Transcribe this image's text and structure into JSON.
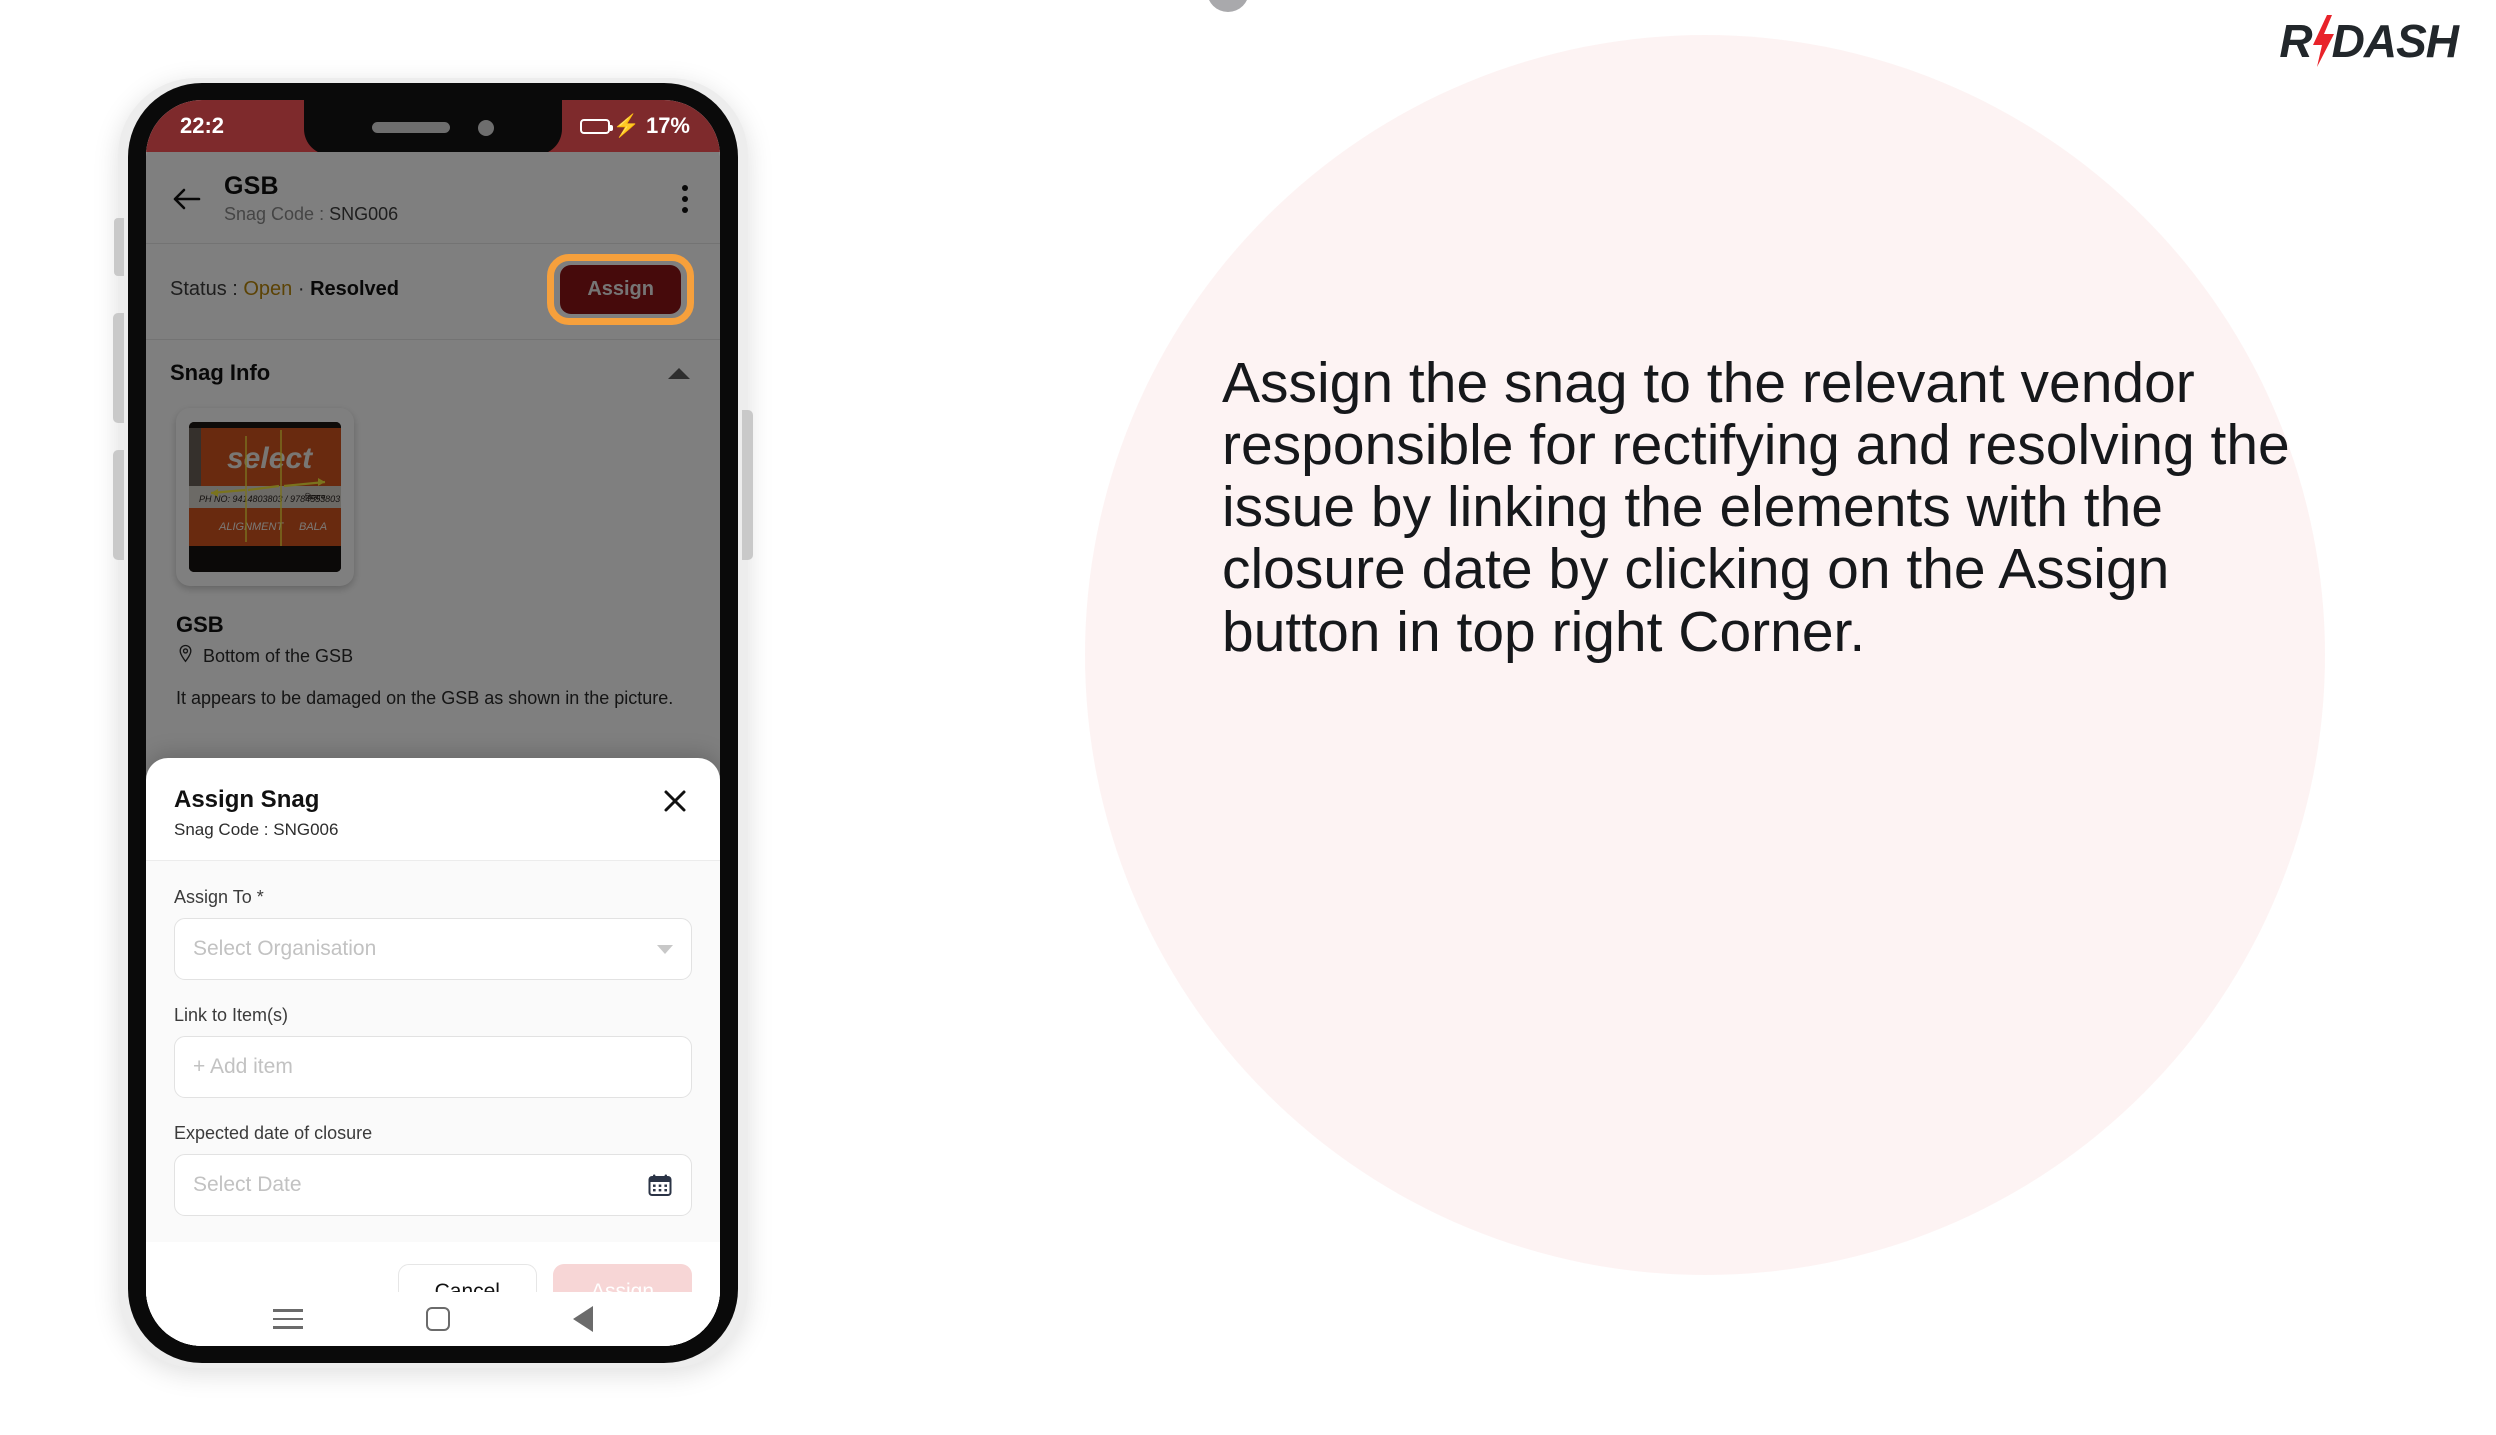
{
  "brand": {
    "logo_prefix": "R",
    "logo_suffix": "DASH",
    "bolt_color": "#e8232a",
    "logo_color": "#22272b"
  },
  "instruction": {
    "text": "Assign the snag to the relevant vendor responsible for rectifying and resolving the issue by linking the elements with the closure date by clicking on the Assign button in top right Corner."
  },
  "phone": {
    "status_bar": {
      "time": "22:2",
      "battery_percent": "17%",
      "charging": true,
      "background_color": "#7e2a2c"
    },
    "app_bar": {
      "back_icon": "arrow-left-icon",
      "title": "GSB",
      "subtitle_label": "Snag Code : ",
      "subtitle_value": "SNG006",
      "menu_icon": "kebab-menu-icon"
    },
    "status_row": {
      "label": "Status : ",
      "open": "Open",
      "separator": " · ",
      "resolved": "Resolved",
      "open_color": "#b8860b",
      "assign_label": "Assign",
      "assign_bg": "#8d1417",
      "highlight_color": "#f6a03c"
    },
    "snag_info": {
      "section_title": "Snag Info",
      "collapse_icon": "caret-up-icon",
      "thumbnail_alt": "snag-photo",
      "item_title": "GSB",
      "location_icon": "location-pin-icon",
      "location": "Bottom of the GSB",
      "description": "It appears to be damaged on the GSB as shown in the picture."
    },
    "sheet": {
      "title": "Assign Snag",
      "subtitle_label": "Snag Code : ",
      "subtitle_value": "SNG006",
      "close_icon": "close-icon",
      "fields": [
        {
          "label": "Assign To ",
          "required_mark": "*",
          "placeholder": "Select Organisation",
          "trailing_icon": "chevron-down-icon"
        },
        {
          "label": "Link to Item(s)",
          "required_mark": "",
          "placeholder": "+ Add item",
          "trailing_icon": ""
        },
        {
          "label": "Expected date of closure",
          "required_mark": "",
          "placeholder": "Select Date",
          "trailing_icon": "calendar-icon"
        }
      ],
      "cancel_label": "Cancel",
      "assign_label": "Assign",
      "assign_disabled_bg": "#f7d6d6"
    },
    "nav_bar": {
      "recents_icon": "hamburger-icon",
      "home_icon": "home-square-icon",
      "back_icon": "back-triangle-icon"
    }
  }
}
